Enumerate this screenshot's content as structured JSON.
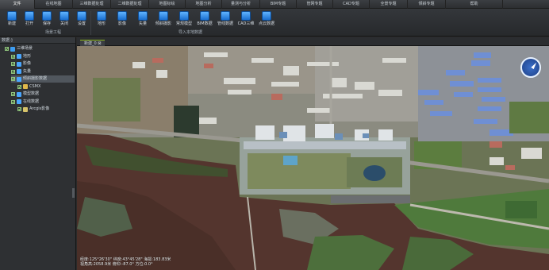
{
  "menu": {
    "tabs": [
      "文件",
      "在线地图",
      "三维数据处理",
      "二维数据处理",
      "地图标绘",
      "地图分析",
      "量测与分析",
      "BIM专题",
      "管网专题",
      "CAD专题",
      "全景专题",
      "倾斜专题",
      "帮助"
    ],
    "active_index": 0
  },
  "ribbon": {
    "group1": {
      "label": "场景工程",
      "buttons": [
        {
          "label": "新建",
          "icon": "new-project-icon"
        },
        {
          "label": "打开",
          "icon": "open-folder-icon"
        },
        {
          "label": "保存",
          "icon": "save-icon"
        },
        {
          "label": "关闭",
          "icon": "close-project-icon"
        },
        {
          "label": "设置",
          "icon": "settings-icon"
        }
      ]
    },
    "group2": {
      "label": "导入本地数据",
      "buttons": [
        {
          "label": "地形",
          "icon": "terrain-icon"
        },
        {
          "label": "影像",
          "icon": "imagery-icon"
        },
        {
          "label": "矢量",
          "icon": "vector-icon"
        },
        {
          "label": "倾斜摄影",
          "icon": "oblique-photo-icon"
        },
        {
          "label": "常规模型",
          "icon": "model-icon"
        },
        {
          "label": "BIM数据",
          "icon": "bim-icon"
        },
        {
          "label": "管线数据",
          "icon": "pipeline-icon"
        },
        {
          "label": "CAD三维",
          "icon": "cad-3d-icon"
        },
        {
          "label": "点云数据",
          "icon": "point-cloud-icon"
        }
      ]
    }
  },
  "layer_panel": {
    "title": "数据 ◊",
    "items": [
      {
        "label": "三维场景",
        "level": 0,
        "icon": "scene-icon",
        "color": "#3d9df2",
        "selected": false
      },
      {
        "label": "地形",
        "level": 1,
        "icon": "terrain-layer-icon",
        "color": "#49a6ff",
        "selected": false
      },
      {
        "label": "影像",
        "level": 1,
        "icon": "imagery-layer-icon",
        "color": "#49a6ff",
        "selected": false
      },
      {
        "label": "矢量",
        "level": 1,
        "icon": "vector-layer-icon",
        "color": "#49a6ff",
        "selected": false
      },
      {
        "label": "倾斜摄影数据",
        "level": 1,
        "icon": "oblique-layer-icon",
        "color": "#49a6ff",
        "selected": true
      },
      {
        "label": "CSMX",
        "level": 2,
        "icon": "csmx-icon",
        "color": "#e0b84a",
        "selected": false
      },
      {
        "label": "模型数据",
        "level": 1,
        "icon": "model-layer-icon",
        "color": "#49a6ff",
        "selected": false
      },
      {
        "label": "在线数据",
        "level": 1,
        "icon": "online-data-icon",
        "color": "#49a6ff",
        "selected": false
      },
      {
        "label": "Arcgis影像",
        "level": 2,
        "icon": "arcgis-imagery-icon",
        "color": "#d7c36a",
        "selected": false
      }
    ]
  },
  "map": {
    "tab_label": "新建_0 ⊠",
    "status_line1": "经度:125°26'30\" 纬度:43°45'28\" 海拔:183.83米",
    "status_line2": "视角高:2058.9米 俯仰:-87.0° 方位:0.0°"
  }
}
